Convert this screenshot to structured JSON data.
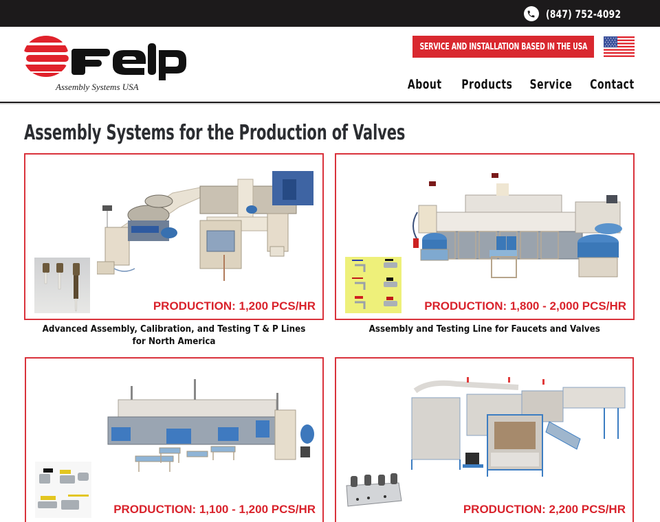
{
  "topbar": {
    "phone_icon": "phone-icon",
    "phone": "(847) 752-4092"
  },
  "header": {
    "logo": {
      "brand": "Felp",
      "tagline": "Assembly Systems USA",
      "colors": {
        "red": "#e0222b",
        "black": "#111111"
      }
    },
    "usa_banner": "SERVICE AND INSTALLATION BASED IN THE USA",
    "flag_icon": "usa-flag-icon",
    "nav": [
      {
        "label": "About"
      },
      {
        "label": "Products"
      },
      {
        "label": "Service"
      },
      {
        "label": "Contact"
      }
    ]
  },
  "main": {
    "title": "Assembly Systems for the Production of Valves",
    "accent_color": "#d9232c",
    "products": [
      {
        "production": "PRODUCTION: 1,200 PCS/HR",
        "caption": "Advanced Assembly, Calibration, and Testing T & P Lines for North America",
        "image": "assembly-line-machine-image",
        "thumb": "tp-valves-thumbnail"
      },
      {
        "production": "PRODUCTION: 1,800 - 2,000 PCS/HR",
        "caption": "Assembly and Testing Line for Faucets and Valves",
        "image": "faucet-line-machine-image",
        "thumb": "faucets-thumbnail"
      },
      {
        "production": "PRODUCTION: 1,100 - 1,200 PCS/HR",
        "caption": "",
        "image": "ball-valve-line-machine-image",
        "thumb": "ball-valves-thumbnail"
      },
      {
        "production": "PRODUCTION: 2,200 PCS/HR",
        "caption": "",
        "image": "manifold-line-machine-image",
        "thumb": "manifold-thumbnail"
      }
    ]
  }
}
